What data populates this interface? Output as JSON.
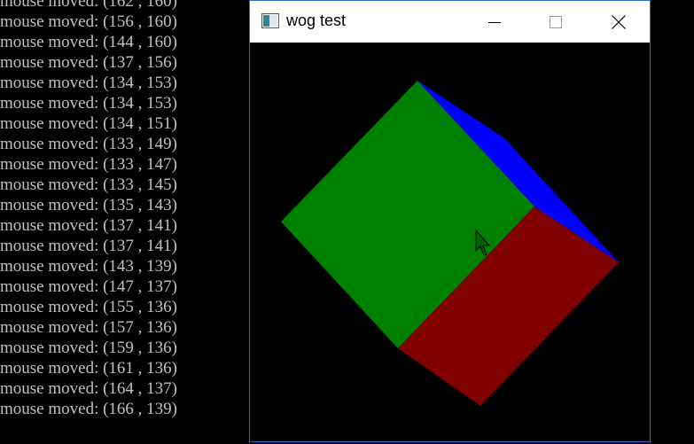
{
  "console": {
    "lines": [
      "mouse moved: (162 , 160)",
      "mouse moved: (156 , 160)",
      "mouse moved: (144 , 160)",
      "mouse moved: (137 , 156)",
      "mouse moved: (134 , 153)",
      "mouse moved: (134 , 153)",
      "mouse moved: (134 , 151)",
      "mouse moved: (133 , 149)",
      "mouse moved: (133 , 147)",
      "mouse moved: (133 , 145)",
      "mouse moved: (135 , 143)",
      "mouse moved: (137 , 141)",
      "mouse moved: (137 , 141)",
      "mouse moved: (143 , 139)",
      "mouse moved: (147 , 137)",
      "mouse moved: (155 , 136)",
      "mouse moved: (157 , 136)",
      "mouse moved: (159 , 136)",
      "mouse moved: (161 , 136)",
      "mouse moved: (164 , 137)",
      "mouse moved: (166 , 139)"
    ]
  },
  "window": {
    "title": "wog test",
    "icon": "app-window-icon",
    "controls": [
      "minimize-icon",
      "maximize-icon",
      "close-icon"
    ]
  },
  "scene": {
    "faces": [
      {
        "name": "cube-face-top",
        "color": "#0000ff"
      },
      {
        "name": "cube-face-front",
        "color": "#008000"
      },
      {
        "name": "cube-face-side",
        "color": "#800000"
      }
    ],
    "cursor": "arrow-cursor-icon"
  },
  "colors": {
    "background": "#000000",
    "console_text": "#c0c0c0",
    "window_border": "#2b6fc9"
  }
}
